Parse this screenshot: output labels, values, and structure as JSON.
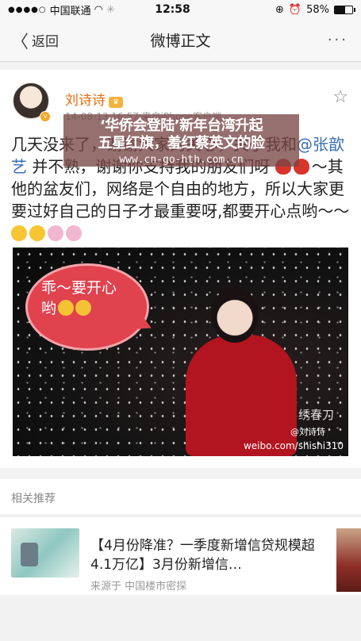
{
  "status_bar": {
    "carrier": "中国联通",
    "time": "12:58",
    "battery": "58%",
    "battery_level": 0.58
  },
  "nav": {
    "back_label": "返回",
    "title": "微博正文"
  },
  "post": {
    "author": "刘诗诗",
    "meta": "14-08-13 16:57  来自iPhone客户端",
    "text_line1": "几天没来了，谢谢大家的关心，关于我和",
    "mention": "@张歆艺",
    "text_line2": "并不熟，谢谢你支持我的朋友们呀",
    "text_line3": "～其他的盆友们，网络是个自由的地方，所以大家更要过好自己的日子才最重要呀,都要开心点哟～～",
    "image_bubble_text": "乖～要开心哟",
    "image_signature": "绣春刀",
    "image_credit": "@刘诗诗",
    "image_url": "weibo.com/shishi310"
  },
  "watermark": {
    "line1": "‘华侨会登陆’新年台湾升起",
    "line2": "五星红旗，羞红蔡英文的脸",
    "url": "www.cn-go-hth.com.cn"
  },
  "related": {
    "header": "相关推荐",
    "item": {
      "title": "【4月份降准？一季度新增信贷规模超4.1万亿】3月份新增信…",
      "source": "来源于 中国楼市密探"
    }
  }
}
